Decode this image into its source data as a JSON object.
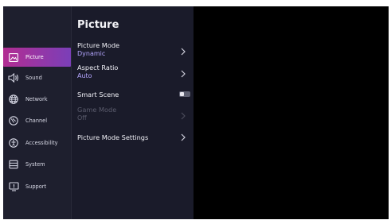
{
  "colors": {
    "accent_from": "#b22d92",
    "accent_to": "#7b3fb8",
    "value_text": "#b4a6ff",
    "disabled_text": "#5a5b6c"
  },
  "sidebar": {
    "items": [
      {
        "label": "Picture",
        "icon": "picture-icon",
        "active": true
      },
      {
        "label": "Sound",
        "icon": "speaker-icon"
      },
      {
        "label": "Network",
        "icon": "globe-icon"
      },
      {
        "label": "Channel",
        "icon": "antenna-icon"
      },
      {
        "label": "Accessibility",
        "icon": "accessibility-icon"
      },
      {
        "label": "System",
        "icon": "system-icon"
      },
      {
        "label": "Support",
        "icon": "support-icon"
      }
    ]
  },
  "panel": {
    "title": "Picture",
    "rows": [
      {
        "label": "Picture Mode",
        "value": "Dynamic",
        "control": "chevron-right-icon"
      },
      {
        "label": "Aspect Ratio",
        "value": "Auto",
        "control": "chevron-right-icon"
      },
      {
        "label": "Smart Scene",
        "control": "toggle",
        "toggle_on": false
      },
      {
        "label": "Game Mode",
        "value": "Off",
        "control": "chevron-right-icon",
        "disabled": true
      },
      {
        "label": "Picture Mode Settings",
        "control": "chevron-right-icon"
      }
    ]
  }
}
